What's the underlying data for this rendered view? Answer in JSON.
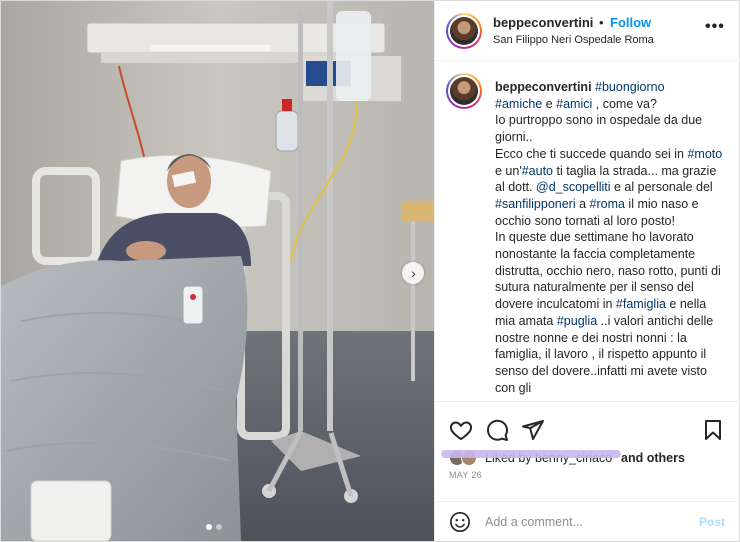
{
  "header": {
    "username": "beppeconvertini",
    "separator": "•",
    "follow_label": "Follow",
    "location": "San Filippo Neri Ospedale Roma",
    "more_label": "•••"
  },
  "caption": {
    "username": "beppeconvertini",
    "segments": [
      {
        "t": "tag",
        "v": "#buongiorno"
      },
      {
        "t": "br"
      },
      {
        "t": "tag",
        "v": "#amiche"
      },
      {
        "t": "txt",
        "v": " e "
      },
      {
        "t": "tag",
        "v": "#amici"
      },
      {
        "t": "txt",
        "v": " , come va?"
      },
      {
        "t": "br"
      },
      {
        "t": "txt",
        "v": "Io purtroppo sono in ospedale da due giorni.."
      },
      {
        "t": "br"
      },
      {
        "t": "txt",
        "v": "Ecco che ti succede quando sei in "
      },
      {
        "t": "tag",
        "v": "#moto"
      },
      {
        "t": "txt",
        "v": " e un'"
      },
      {
        "t": "tag",
        "v": "#auto"
      },
      {
        "t": "txt",
        "v": " ti taglia la strada... ma grazie al dott. "
      },
      {
        "t": "tag",
        "v": "@d_scopelliti"
      },
      {
        "t": "txt",
        "v": " e al personale del "
      },
      {
        "t": "tag",
        "v": "#sanfilipponeri"
      },
      {
        "t": "txt",
        "v": " a "
      },
      {
        "t": "tag",
        "v": "#roma"
      },
      {
        "t": "txt",
        "v": " il mio naso e occhio sono tornati al loro posto!"
      },
      {
        "t": "br"
      },
      {
        "t": "txt",
        "v": "In queste due settimane ho lavorato nonostante la faccia completamente distrutta, occhio nero, naso rotto, punti di sutura naturalmente per il senso del dovere inculcatomi in "
      },
      {
        "t": "tag",
        "v": "#famiglia"
      },
      {
        "t": "txt",
        "v": " e nella mia amata "
      },
      {
        "t": "tag",
        "v": "#puglia"
      },
      {
        "t": "txt",
        "v": " ..i valori antichi delle nostre nonne e dei nostri nonni : la famiglia, il lavoro , il rispetto appunto il senso del dovere..infatti mi avete visto con gli"
      }
    ]
  },
  "likes": {
    "liked_by_text": "Liked by benny_ciriaco",
    "and_others": "and others"
  },
  "date": "MAY 26",
  "comment": {
    "placeholder": "Add a comment...",
    "post_label": "Post"
  },
  "media": {
    "next_label": "›",
    "slide_count": 2,
    "active_slide": 0
  },
  "colors": {
    "follow": "#0095f6",
    "hashtag": "#00376b",
    "post_disabled": "#b3dbff",
    "border": "#dbdbdb"
  }
}
